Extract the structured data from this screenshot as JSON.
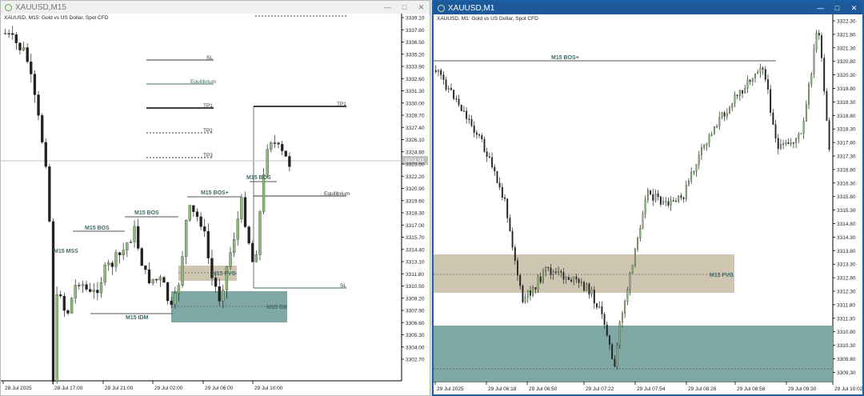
{
  "left": {
    "title": "XAUUSD,M15",
    "symbol_label": "XAUUSD, M15:  Gold vs US Dollar, Spot CFD",
    "price_axis": [
      "3339.10",
      "3337.80",
      "3336.50",
      "3335.20",
      "3333.90",
      "3332.60",
      "3331.30",
      "3330.00",
      "3328.70",
      "3327.40",
      "3326.10",
      "3324.80",
      "3323.50",
      "3322.20",
      "3320.90",
      "3319.60",
      "3318.30",
      "3317.00",
      "3315.70",
      "3314.40",
      "3313.10",
      "3311.80",
      "3310.50",
      "3309.20",
      "3307.90",
      "3306.60",
      "3305.30",
      "3304.00",
      "3302.70"
    ],
    "current_price": "3324.31",
    "time_axis": [
      "28 Jul 2025",
      "28 Jul 17:00",
      "28 Jul 21:00",
      "29 Jul 02:00",
      "29 Jul 06:00",
      "29 Jul 10:00"
    ],
    "annotations": {
      "sl_top": "SL",
      "equilibrium_top": "Equilibrium",
      "tp1_left": "TP1",
      "tp2": "TP2",
      "tp3": "TP3",
      "tp1_right": "TP1",
      "equilibrium_right": "Equilibrium",
      "sl_right": "SL",
      "bos_1": "M15 BOS",
      "bos_2": "M15 BOS",
      "bos_plus": "M15 BOS+",
      "bos_3": "M15 BOS",
      "mss": "M15 MSS",
      "idm": "M15 IDM",
      "fvg": "M15 FVG",
      "ob": "M15 OB"
    }
  },
  "right": {
    "title": "XAUUSD,M1",
    "symbol_label": "XAUUSD, M1:  Gold vs US Dollar, Spot CFD",
    "price_axis": [
      "3322.30",
      "3321.80",
      "3321.30",
      "3320.80",
      "3320.30",
      "3319.80",
      "3319.30",
      "3318.80",
      "3318.30",
      "3317.80",
      "3317.30",
      "3316.80",
      "3316.30",
      "3315.80",
      "3315.30",
      "3314.80",
      "3314.30",
      "3313.80",
      "3313.30",
      "3312.80",
      "3312.30",
      "3311.80",
      "3311.30",
      "3310.80",
      "3310.30",
      "3309.80",
      "3309.30"
    ],
    "time_axis": [
      "29 Jul 2025",
      "29 Jul 06:18",
      "29 Jul 06:50",
      "29 Jul 07:22",
      "29 Jul 07:54",
      "29 Jul 08:26",
      "29 Jul 08:58",
      "29 Jul 09:30",
      "29 Jul 10:02"
    ],
    "annotations": {
      "bos_plus": "M15 BOS+",
      "fvg": "M15 FVG"
    }
  },
  "colors": {
    "bull": "#8db87a",
    "bear": "#222222",
    "fvg_zone": "#cfc6b2",
    "ob_zone": "#7fa8a4",
    "label": "#3e6b6a",
    "active_title": "#1e5a99"
  }
}
